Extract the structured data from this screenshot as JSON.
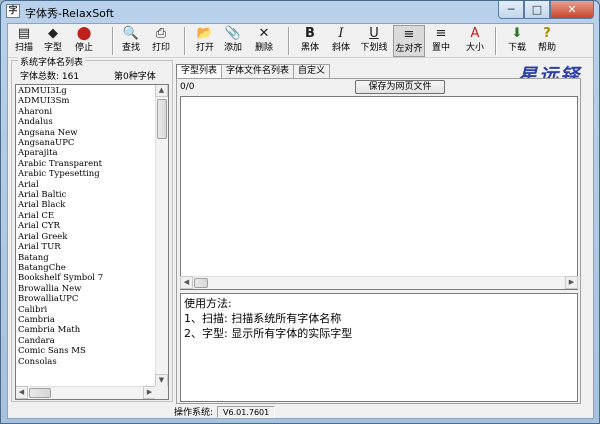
{
  "window": {
    "title": "字体秀-RelaxSoft",
    "icon": "document-icon",
    "controls": [
      "─",
      "□",
      "✕"
    ]
  },
  "toolbar": {
    "buttons": [
      {
        "label": "扫描",
        "icon": "scanner-icon",
        "glyph": "▤"
      },
      {
        "label": "字型",
        "icon": "font-style-icon",
        "glyph": "◆"
      },
      {
        "label": "停止",
        "icon": "stop-icon",
        "glyph": "⬤"
      },
      {
        "label": "查找",
        "icon": "find-icon",
        "glyph": "🔍"
      },
      {
        "label": "打印",
        "icon": "printer-icon",
        "glyph": "⎙"
      },
      {
        "label": "打开",
        "icon": "open-folder-icon",
        "glyph": "📂"
      },
      {
        "label": "添加",
        "icon": "paperclip-icon",
        "glyph": "📎"
      },
      {
        "label": "删除",
        "icon": "delete-icon",
        "glyph": "✕"
      },
      {
        "label": "黑体",
        "icon": "bold-icon",
        "glyph": "B"
      },
      {
        "label": "斜体",
        "icon": "italic-icon",
        "glyph": "I"
      },
      {
        "label": "下划线",
        "icon": "underline-icon",
        "glyph": "U"
      },
      {
        "label": "左对齐",
        "icon": "align-left-icon",
        "glyph": "≡"
      },
      {
        "label": "置中",
        "icon": "align-center-icon",
        "glyph": "≡"
      },
      {
        "label": "大小",
        "icon": "font-size-icon",
        "glyph": "A"
      },
      {
        "label": "下载",
        "icon": "download-icon",
        "glyph": "⬇"
      },
      {
        "label": "帮助",
        "icon": "help-icon",
        "glyph": "?"
      }
    ]
  },
  "sidebar": {
    "title": "系统字体名列表",
    "count_label": "字体总数: 161",
    "index_label": "第0种字体",
    "fonts": [
      "ADMUI3Lg",
      "ADMUI3Sm",
      "Aharoni",
      "Andalus",
      "Angsana New",
      "AngsanaUPC",
      "Aparajita",
      "Arabic Transparent",
      "Arabic Typesetting",
      "Arial",
      "Arial Baltic",
      "Arial Black",
      "Arial CE",
      "Arial CYR",
      "Arial Greek",
      "Arial TUR",
      "Batang",
      "BatangChe",
      "Bookshelf Symbol 7",
      "Browallia New",
      "BrowalliaUPC",
      "Calibri",
      "Cambria",
      "Cambria Math",
      "Candara",
      "Comic Sans MS",
      "Consolas"
    ]
  },
  "tabs": [
    "字型列表",
    "字体文件名列表",
    "自定义"
  ],
  "logo_text": "星远铎",
  "panel": {
    "counter": "0/0",
    "save_button": "保存为网页文件",
    "usage_lines": [
      "使用方法:",
      "1、扫描: 扫描系统所有字体名称",
      "2、字型: 显示所有字体的实际字型"
    ]
  },
  "status": {
    "label": "操作系统:",
    "value": "V6.01.7601"
  }
}
